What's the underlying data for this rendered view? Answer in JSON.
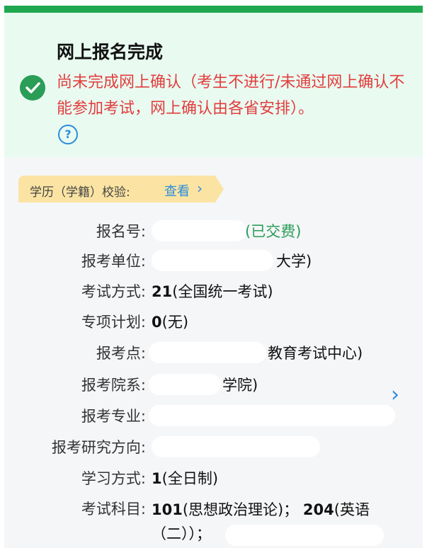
{
  "banner": {
    "title": "网上报名完成",
    "warning": "尚未完成网上确认（考生不进行/未通过网上确认不能参加考试，网上确认由各省安排）。",
    "help_icon": "question-circle-icon",
    "status_icon": "check-circle-icon"
  },
  "verify": {
    "label": "学历（学籍）校验:",
    "link": "查看"
  },
  "fields": {
    "reg_no": {
      "label": "报名号:",
      "status": "(已交费)"
    },
    "unit": {
      "label": "报考单位:",
      "suffix": "大学)"
    },
    "exam_mode": {
      "label": "考试方式:",
      "code": "21",
      "text": "(全国统一考试)"
    },
    "special_plan": {
      "label": "专项计划:",
      "code": "0",
      "text": "(无)"
    },
    "exam_site": {
      "label": "报考点:",
      "suffix": "教育考试中心)"
    },
    "dept": {
      "label": "报考院系:",
      "suffix": "学院)"
    },
    "major": {
      "label": "报考专业:"
    },
    "direction": {
      "label": "报考研究方向:"
    },
    "study_mode": {
      "label": "学习方式:",
      "code": "1",
      "text": "(全日制)"
    },
    "subjects": {
      "label": "考试科目:",
      "code1": "101",
      "text1": "(思想政治理论)；",
      "code2": "204",
      "text2": "(英语（二））；"
    }
  },
  "colors": {
    "accent_green": "#2a9d57",
    "warning_red": "#e23d3d",
    "link_blue": "#2d8cdb"
  }
}
